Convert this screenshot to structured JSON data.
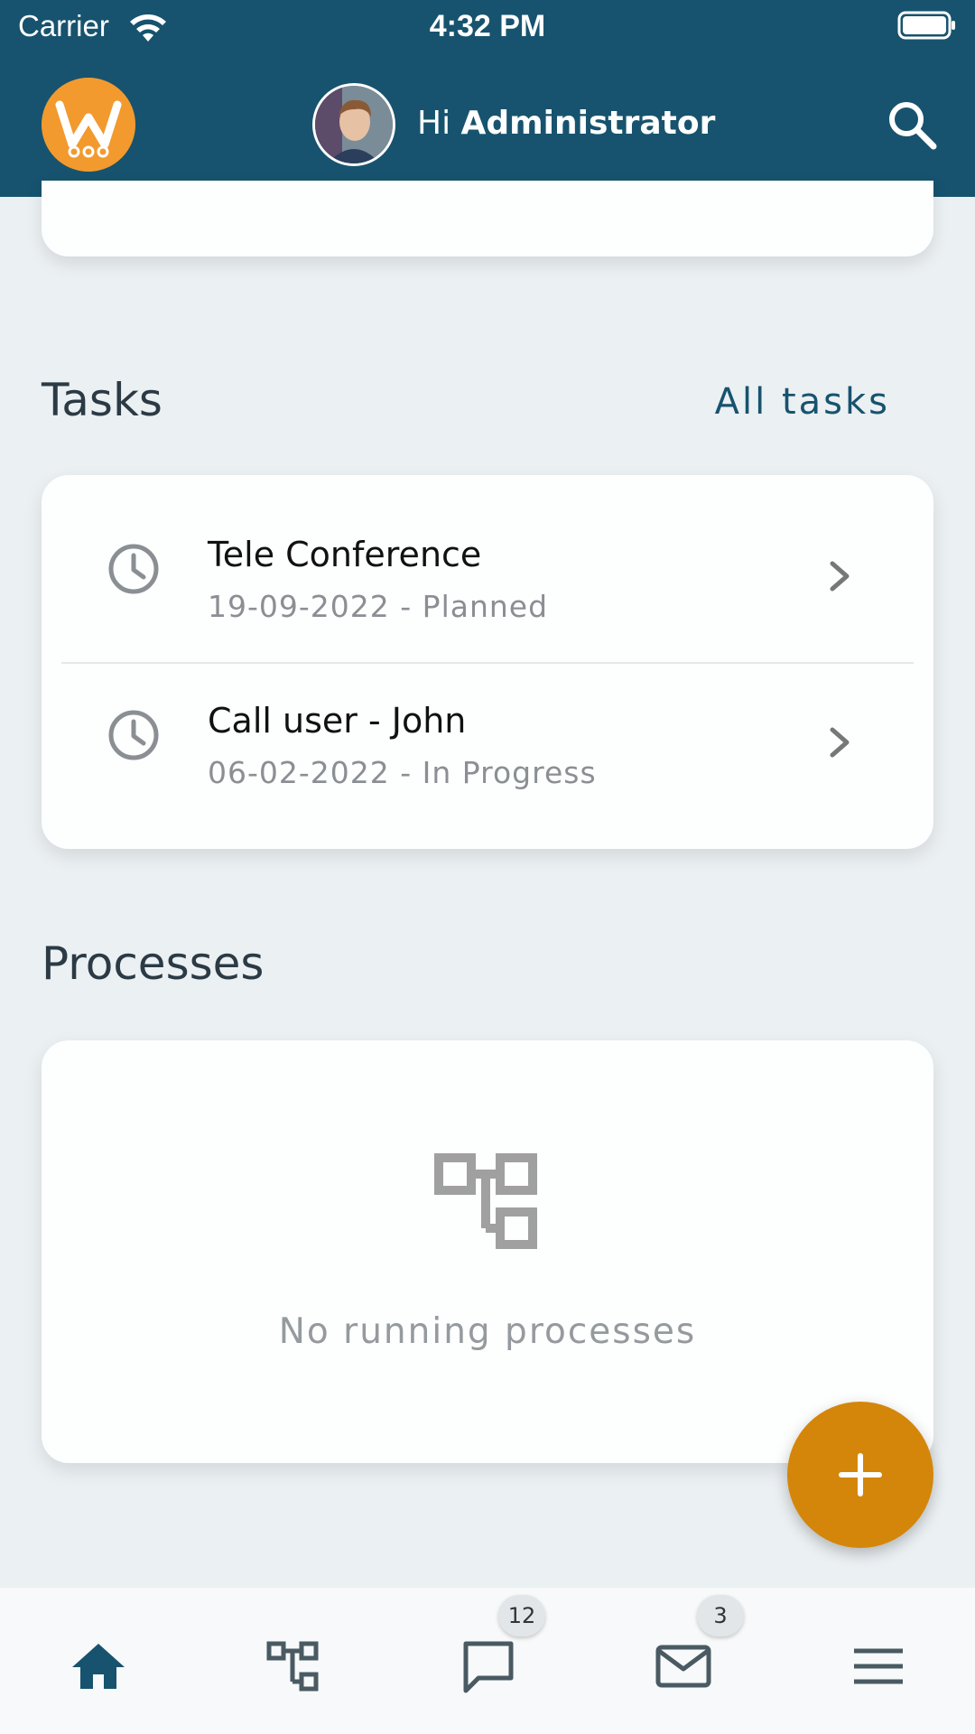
{
  "status_bar": {
    "carrier": "Carrier",
    "time": "4:32 PM"
  },
  "header": {
    "greeting_prefix": "Hi",
    "user_name": "Administrator"
  },
  "tasks": {
    "title": "Tasks",
    "all_link": "All tasks",
    "items": [
      {
        "title": "Tele Conference",
        "subtitle": "19-09-2022 - Planned"
      },
      {
        "title": "Call user - John",
        "subtitle": "06-02-2022 - In Progress"
      }
    ]
  },
  "processes": {
    "title": "Processes",
    "empty_text": "No running processes"
  },
  "bottom_nav": {
    "chat_badge": "12",
    "mail_badge": "3"
  },
  "colors": {
    "primary": "#17536E",
    "accent": "#D4860A",
    "logo": "#F29A2E"
  }
}
